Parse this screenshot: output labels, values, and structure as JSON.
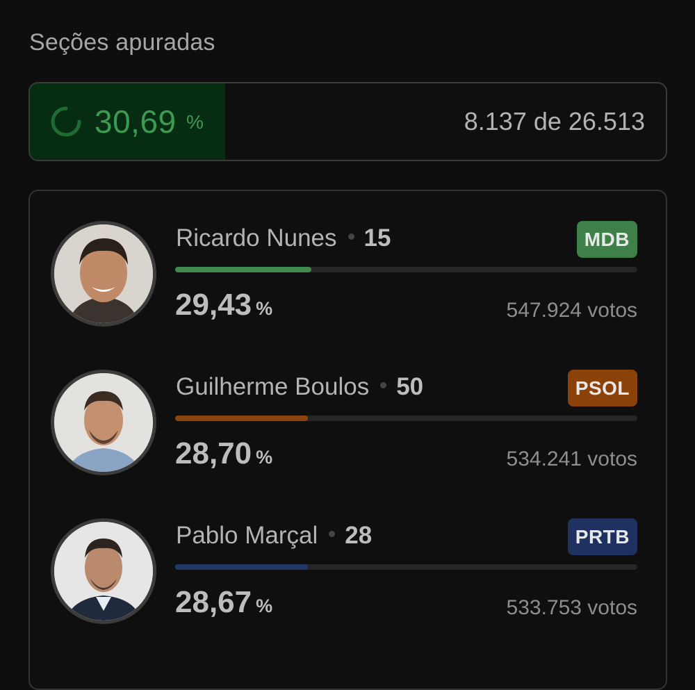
{
  "header": {
    "title": "Seções apuradas"
  },
  "progress": {
    "percent_value": "30,69",
    "percent_sign": "%",
    "fraction": 0.3069,
    "count_text": "8.137 de 26.513",
    "fill_color": "#062c12",
    "icon": "loading-spinner-icon"
  },
  "candidates": [
    {
      "name": "Ricardo Nunes",
      "number": "15",
      "party": "MDB",
      "party_color": "#3f7f49",
      "bar_color": "#3f8a4c",
      "percent": "29,43",
      "percent_sign": "%",
      "share": 0.2943,
      "votes": "547.924 votos"
    },
    {
      "name": "Guilherme Boulos",
      "number": "50",
      "party": "PSOL",
      "party_color": "#8a4208",
      "bar_color": "#8c4511",
      "percent": "28,70",
      "percent_sign": "%",
      "share": 0.287,
      "votes": "534.241 votos"
    },
    {
      "name": "Pablo Marçal",
      "number": "28",
      "party": "PRTB",
      "party_color": "#1e3160",
      "bar_color": "#22386b",
      "percent": "28,67",
      "percent_sign": "%",
      "share": 0.2867,
      "votes": "533.753 votos"
    }
  ]
}
